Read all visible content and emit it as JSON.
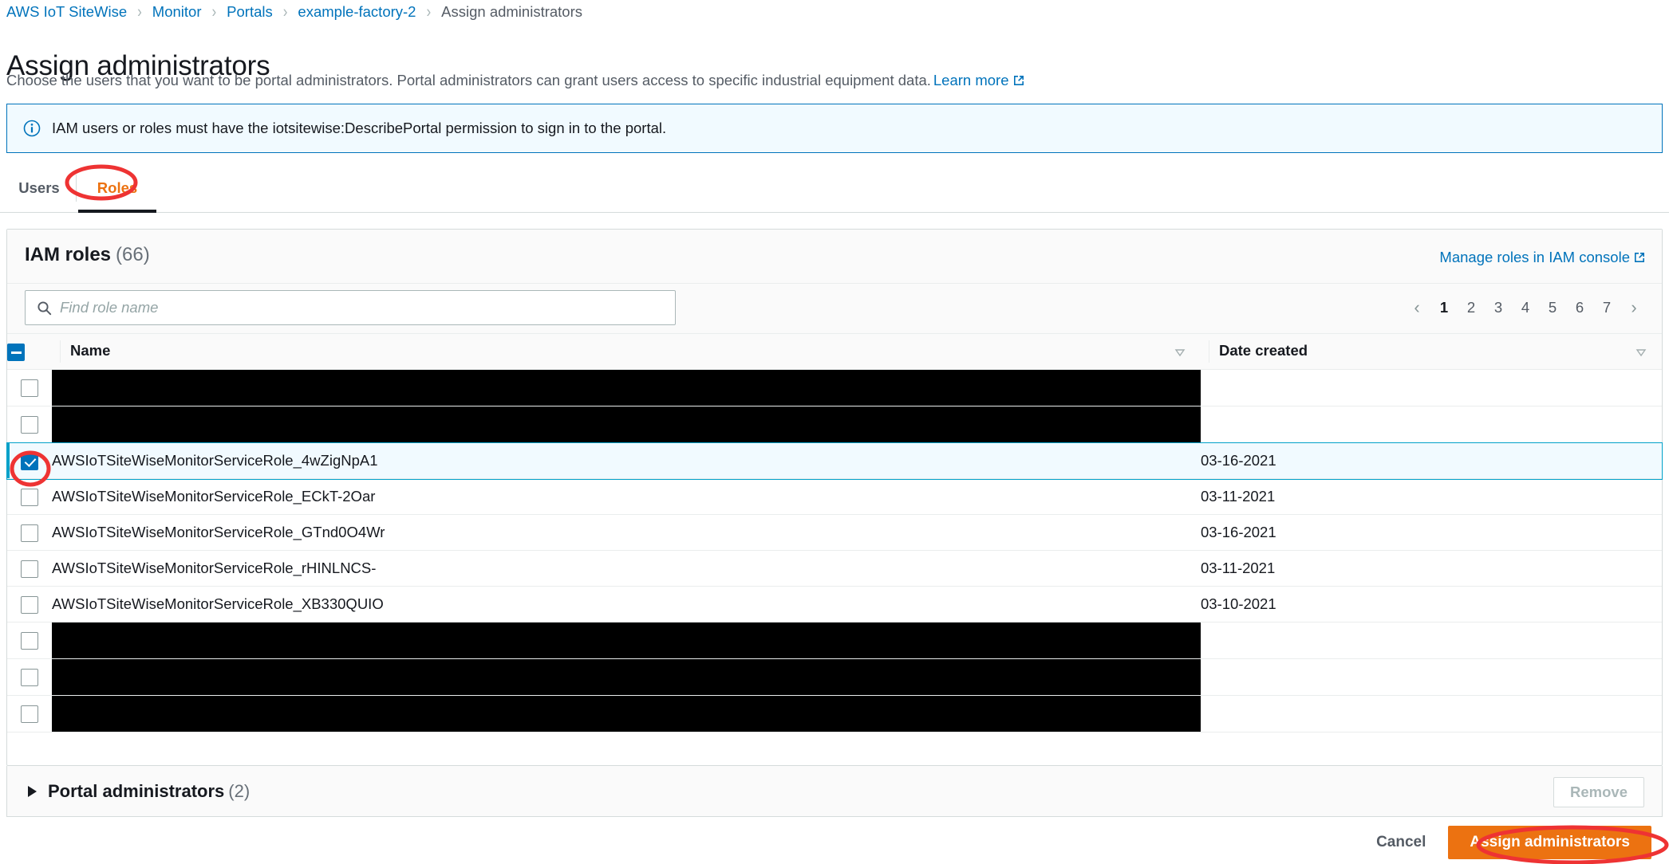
{
  "breadcrumb": {
    "items": [
      {
        "label": "AWS IoT SiteWise",
        "current": false
      },
      {
        "label": "Monitor",
        "current": false
      },
      {
        "label": "Portals",
        "current": false
      },
      {
        "label": "example-factory-2",
        "current": false
      },
      {
        "label": "Assign administrators",
        "current": true
      }
    ],
    "separator": "›"
  },
  "header": {
    "title": "Assign administrators",
    "description": "Choose the users that you want to be portal administrators. Portal administrators can grant users access to specific industrial equipment data.",
    "learn_more": "Learn more",
    "learn_more_icon": "external-link-icon"
  },
  "alert": {
    "icon": "info-circle-icon",
    "text": "IAM users or roles must have the iotsitewise:DescribePortal permission to sign in to the portal.",
    "border_color": "#0073bb",
    "background_color": "#f1faff"
  },
  "tabs": [
    {
      "label": "Users",
      "active": false
    },
    {
      "label": "Roles",
      "active": true
    }
  ],
  "panel": {
    "title": "IAM roles",
    "count": "(66)",
    "manage_link": "Manage roles in IAM console",
    "manage_link_icon": "external-link-icon"
  },
  "search": {
    "placeholder": "Find role name",
    "value": "",
    "icon": "search-icon"
  },
  "pagination": {
    "prev_icon": "chevron-left-icon",
    "next_icon": "chevron-right-icon",
    "pages": [
      "1",
      "2",
      "3",
      "4",
      "5",
      "6",
      "7"
    ],
    "current": "1"
  },
  "table": {
    "select_all_state": "indeterminate",
    "columns": [
      {
        "label": "Name",
        "sort_icon": "sort-descending-icon"
      },
      {
        "label": "Date created",
        "sort_icon": "sort-descending-icon"
      }
    ],
    "rows": [
      {
        "name": "",
        "date": "",
        "checked": false,
        "redacted": true
      },
      {
        "name": "",
        "date": "",
        "checked": false,
        "redacted": true
      },
      {
        "name": "AWSIoTSiteWiseMonitorServiceRole_4wZigNpA1",
        "date": "03-16-2021",
        "checked": true,
        "redacted": false
      },
      {
        "name": "AWSIoTSiteWiseMonitorServiceRole_ECkT-2Oar",
        "date": "03-11-2021",
        "checked": false,
        "redacted": false
      },
      {
        "name": "AWSIoTSiteWiseMonitorServiceRole_GTnd0O4Wr",
        "date": "03-16-2021",
        "checked": false,
        "redacted": false
      },
      {
        "name": "AWSIoTSiteWiseMonitorServiceRole_rHINLNCS-",
        "date": "03-11-2021",
        "checked": false,
        "redacted": false
      },
      {
        "name": "AWSIoTSiteWiseMonitorServiceRole_XB330QUIO",
        "date": "03-10-2021",
        "checked": false,
        "redacted": false
      },
      {
        "name": "",
        "date": "",
        "checked": false,
        "redacted": true
      },
      {
        "name": "",
        "date": "",
        "checked": false,
        "redacted": true
      },
      {
        "name": "",
        "date": "",
        "checked": false,
        "redacted": true
      }
    ]
  },
  "portal_admins": {
    "title": "Portal administrators",
    "count": "(2)",
    "expanded": false,
    "caret_icon": "caret-right-icon",
    "remove_label": "Remove",
    "remove_disabled": true
  },
  "footer": {
    "cancel_label": "Cancel",
    "primary_label": "Assign administrators",
    "primary_color": "#ec7211"
  },
  "annotations": {
    "color": "#ee3333",
    "items": [
      {
        "name": "roles-tab-highlight",
        "target": "Roles"
      },
      {
        "name": "selected-row-checkbox-highlight",
        "target": "row-checkbox"
      },
      {
        "name": "assign-administrators-button-highlight",
        "target": "Assign administrators"
      }
    ]
  }
}
